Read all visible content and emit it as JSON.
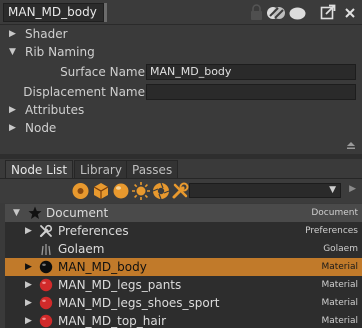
{
  "node": {
    "name": "MAN_MD_body"
  },
  "sections": [
    {
      "label": "Shader",
      "expanded": false
    },
    {
      "label": "Rib Naming",
      "expanded": true
    },
    {
      "label": "Attributes",
      "expanded": false
    },
    {
      "label": "Node",
      "expanded": false
    }
  ],
  "rib_naming": {
    "surface_name_label": "Surface Name",
    "surface_name_value": "MAN_MD_body",
    "displacement_name_label": "Displacement Name",
    "displacement_name_value": ""
  },
  "tabs": [
    "Node List",
    "Library",
    "Passes"
  ],
  "active_tab": "Node List",
  "filter_dropdown": {
    "value": ""
  },
  "tree": [
    {
      "name": "Document",
      "type": "Document",
      "icon": "star-icon",
      "expanded": true,
      "indent": 0
    },
    {
      "name": "Preferences",
      "type": "Preferences",
      "icon": "wrench-icon",
      "expanded": false,
      "indent": 1
    },
    {
      "name": "Golaem",
      "type": "Golaem",
      "icon": "golaem-icon",
      "expanded": null,
      "indent": 1
    },
    {
      "name": "MAN_MD_body",
      "type": "Material",
      "icon": "black-material-icon",
      "expanded": false,
      "indent": 1,
      "selected": true
    },
    {
      "name": "MAN_MD_legs_pants",
      "type": "Material",
      "icon": "red-material-icon",
      "expanded": false,
      "indent": 1
    },
    {
      "name": "MAN_MD_legs_shoes_sport",
      "type": "Material",
      "icon": "red-material-icon",
      "expanded": false,
      "indent": 1
    },
    {
      "name": "MAN_MD_top_hair",
      "type": "Material",
      "icon": "red-material-icon",
      "expanded": false,
      "indent": 1
    }
  ],
  "colors": {
    "selection": "#c17a2a",
    "accent_orange": "#e8992e",
    "material_red": "#d12a2a"
  }
}
